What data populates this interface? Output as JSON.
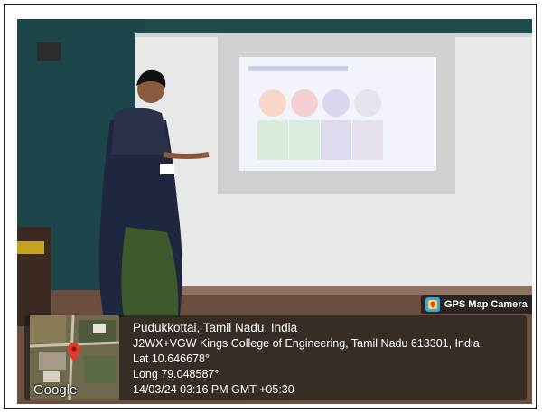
{
  "watermark": {
    "app_name": "GPS Map Camera",
    "map_attribution": "Google"
  },
  "location": {
    "title": "Pudukkottai, Tamil Nadu, India",
    "address": "J2WX+VGW Kings College of Engineering, Tamil Nadu 613301, India",
    "latitude": "Lat 10.646678°",
    "longitude": "Long 79.048587°",
    "timestamp": "14/03/24 03:16 PM GMT +05:30"
  },
  "icons": {
    "badge": "gps-map-camera-icon",
    "pin": "map-pin-icon"
  },
  "colors": {
    "wall_teal": "#1f4a4d",
    "whiteboard": "#e9ecea",
    "map_pin": "#e03a2f"
  }
}
